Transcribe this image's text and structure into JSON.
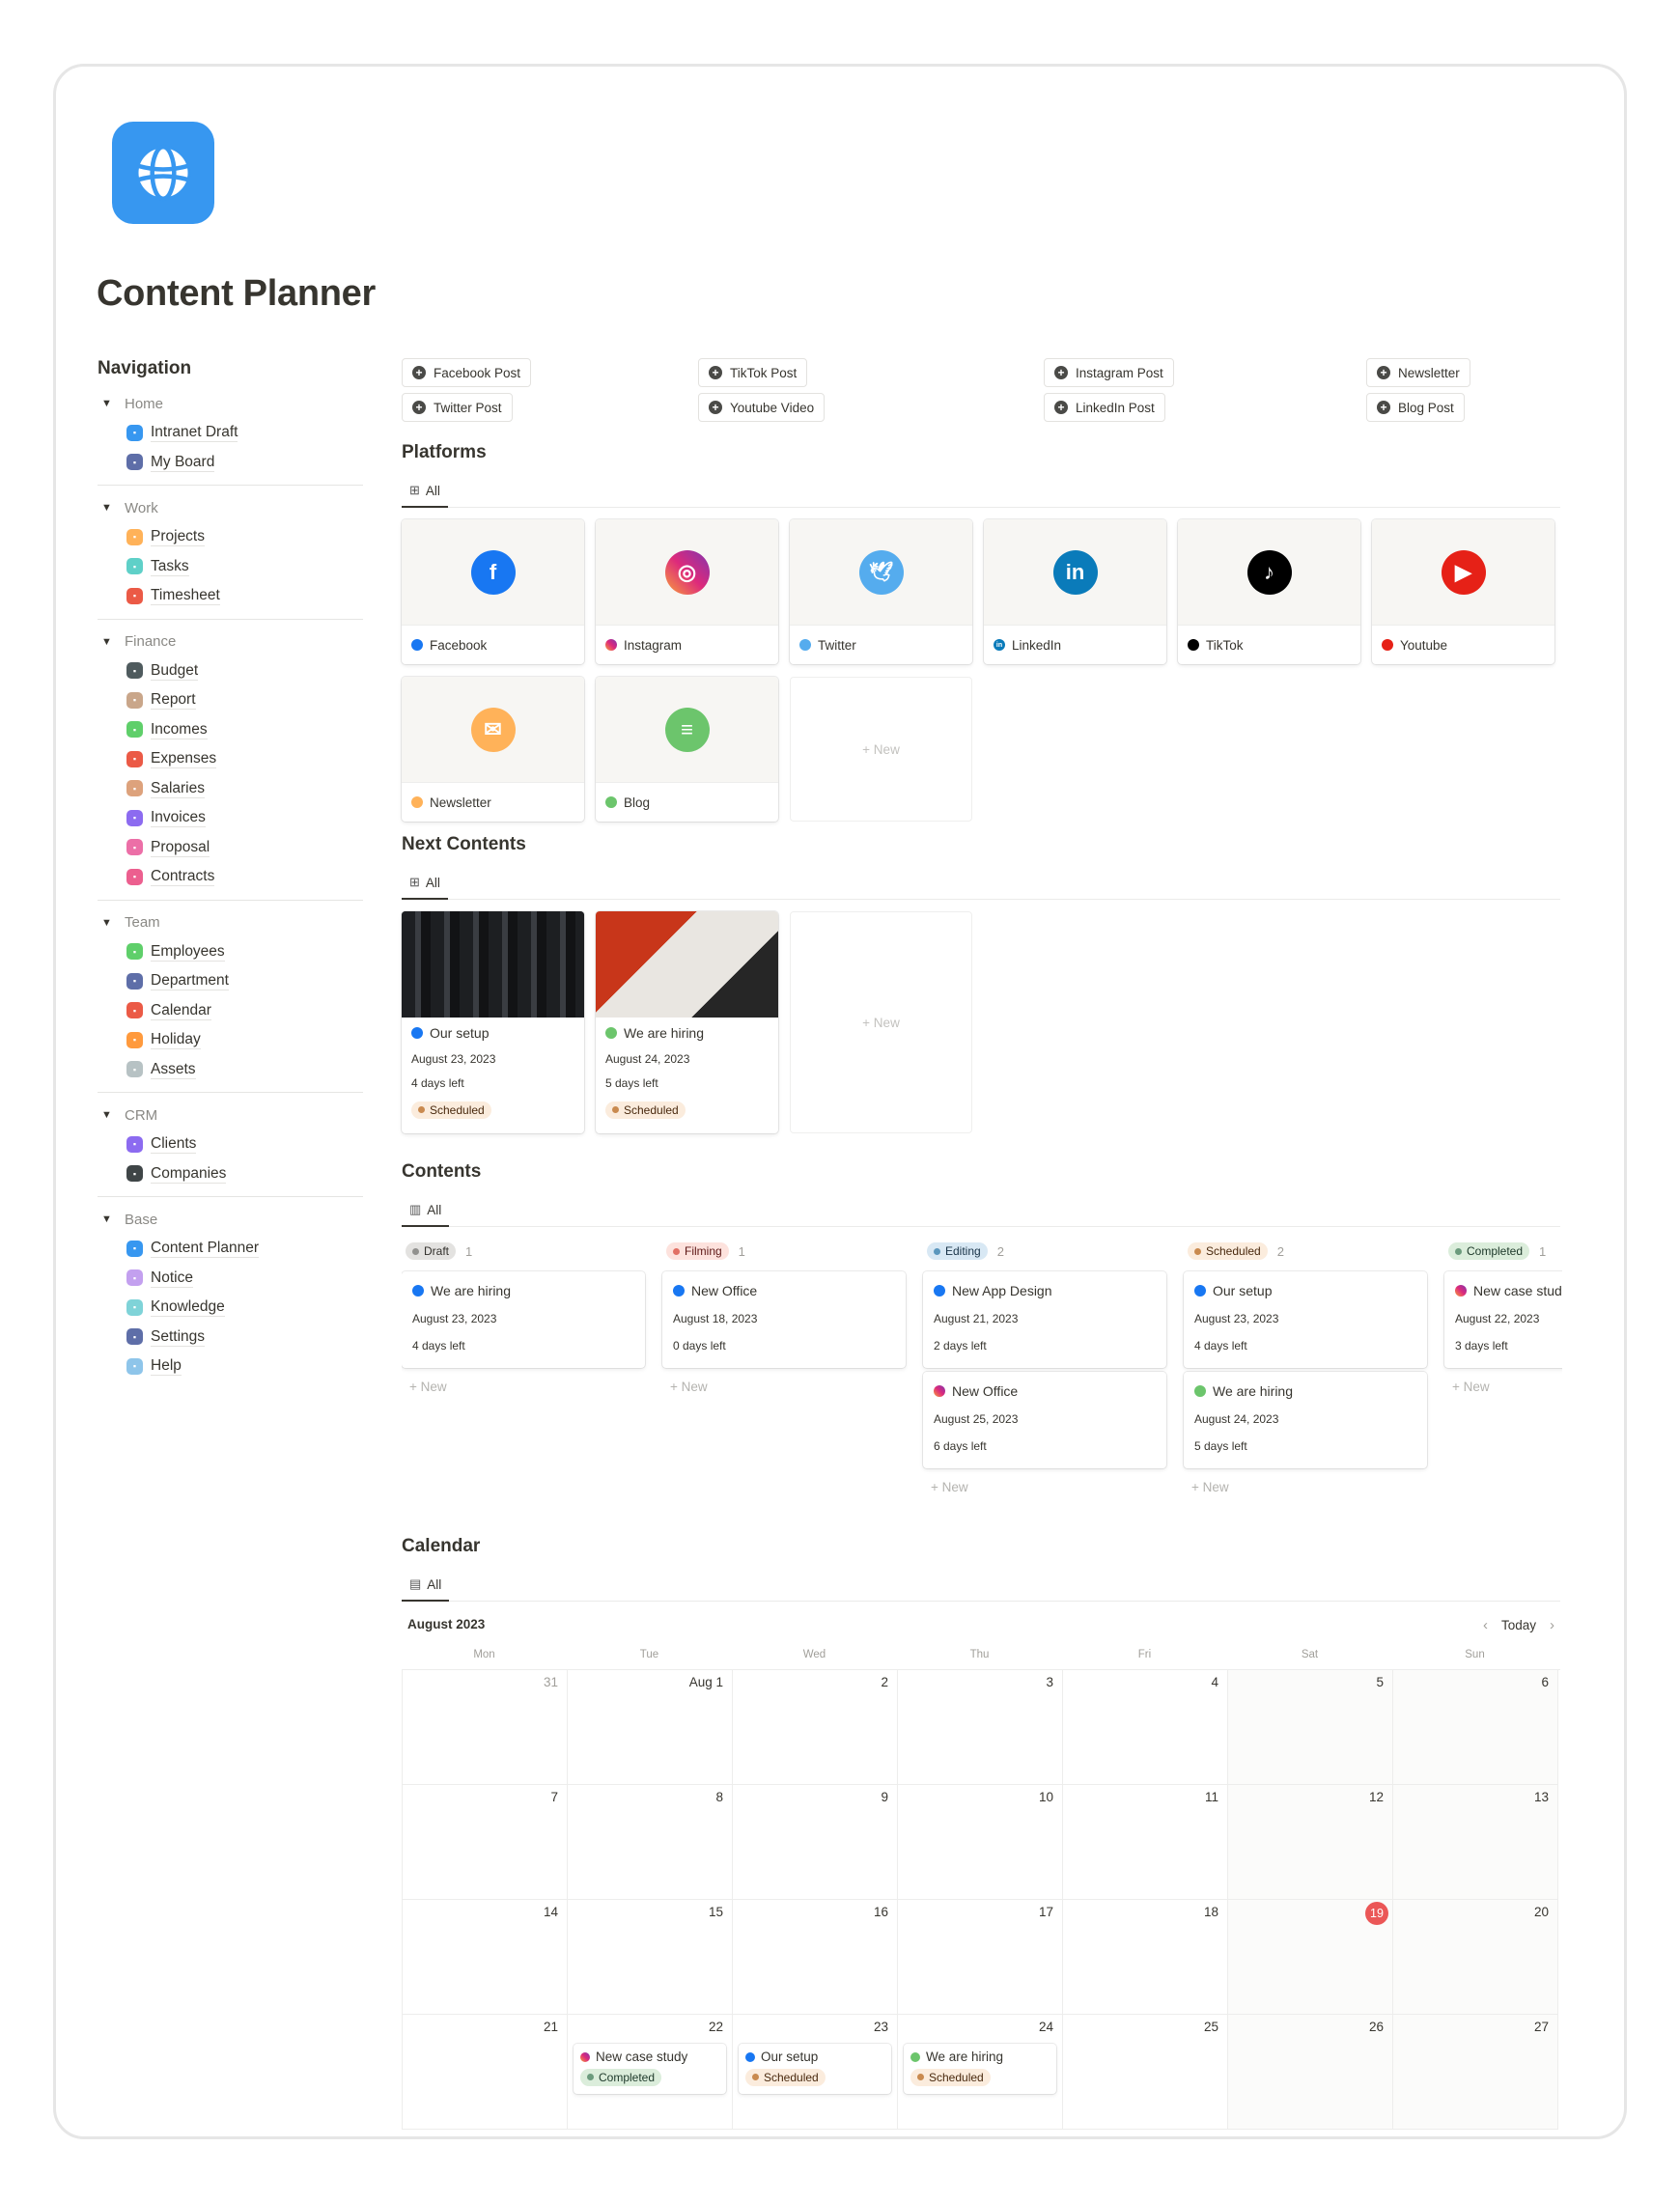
{
  "page": {
    "title": "Content Planner",
    "icon": "globe-icon",
    "accent": "#3797f0"
  },
  "sidebar": {
    "heading": "Navigation",
    "groups": [
      {
        "title": "Home",
        "items": [
          {
            "label": "Intranet Draft",
            "icon": "intranet-icon",
            "color": "#3797f0"
          },
          {
            "label": "My Board",
            "icon": "user-icon",
            "color": "#5e6ea8"
          }
        ]
      },
      {
        "title": "Work",
        "items": [
          {
            "label": "Projects",
            "icon": "folder-icon",
            "color": "#ffb259"
          },
          {
            "label": "Tasks",
            "icon": "check-icon",
            "color": "#5fd0c8"
          },
          {
            "label": "Timesheet",
            "icon": "clock-icon",
            "color": "#eb5a46"
          }
        ]
      },
      {
        "title": "Finance",
        "items": [
          {
            "label": "Budget",
            "icon": "budget-icon",
            "color": "#4f5b5e"
          },
          {
            "label": "Report",
            "icon": "report-icon",
            "color": "#c9a68a"
          },
          {
            "label": "Incomes",
            "icon": "incomes-icon",
            "color": "#5fcf6a"
          },
          {
            "label": "Expenses",
            "icon": "expenses-icon",
            "color": "#eb5a46"
          },
          {
            "label": "Salaries",
            "icon": "salaries-icon",
            "color": "#dda27c"
          },
          {
            "label": "Invoices",
            "icon": "invoice-icon",
            "color": "#8c6bf0"
          },
          {
            "label": "Proposal",
            "icon": "proposal-icon",
            "color": "#ec6fa7"
          },
          {
            "label": "Contracts",
            "icon": "contract-icon",
            "color": "#ec5f8f"
          }
        ]
      },
      {
        "title": "Team",
        "items": [
          {
            "label": "Employees",
            "icon": "employees-icon",
            "color": "#5fcf6a"
          },
          {
            "label": "Department",
            "icon": "department-icon",
            "color": "#5e6ea8"
          },
          {
            "label": "Calendar",
            "icon": "calendar-icon",
            "color": "#eb5a46"
          },
          {
            "label": "Holiday",
            "icon": "holiday-icon",
            "color": "#ff9a3d"
          },
          {
            "label": "Assets",
            "icon": "assets-icon",
            "color": "#b7c2c4"
          }
        ]
      },
      {
        "title": "CRM",
        "items": [
          {
            "label": "Clients",
            "icon": "clients-icon",
            "color": "#8c6bf0"
          },
          {
            "label": "Companies",
            "icon": "companies-icon",
            "color": "#3f4547"
          }
        ]
      },
      {
        "title": "Base",
        "items": [
          {
            "label": "Content Planner",
            "icon": "globe-icon",
            "color": "#3797f0"
          },
          {
            "label": "Notice",
            "icon": "notice-icon",
            "color": "#c3a0ef"
          },
          {
            "label": "Knowledge",
            "icon": "knowledge-icon",
            "color": "#7fd3d8"
          },
          {
            "label": "Settings",
            "icon": "settings-icon",
            "color": "#5e6ea8"
          },
          {
            "label": "Help",
            "icon": "help-icon",
            "color": "#8ec5ea"
          }
        ]
      }
    ]
  },
  "quick_buttons": [
    "Facebook Post",
    "Twitter Post",
    "TikTok Post",
    "Youtube Video",
    "Instagram Post",
    "LinkedIn Post",
    "Newsletter",
    "Blog Post"
  ],
  "platforms": {
    "title": "Platforms",
    "view_label": "All",
    "items": [
      {
        "label": "Facebook",
        "icon": "facebook-icon",
        "glyph": "f",
        "color": "#1877f2"
      },
      {
        "label": "Instagram",
        "icon": "instagram-icon",
        "glyph": "◎",
        "color": "#dd2a7b"
      },
      {
        "label": "Twitter",
        "icon": "twitter-icon",
        "glyph": "🕊",
        "color": "#55acee"
      },
      {
        "label": "LinkedIn",
        "icon": "linkedin-icon",
        "glyph": "in",
        "color": "#0a7bba"
      },
      {
        "label": "TikTok",
        "icon": "tiktok-icon",
        "glyph": "♪",
        "color": "#000000"
      },
      {
        "label": "Youtube",
        "icon": "youtube-icon",
        "glyph": "▶",
        "color": "#e62117"
      },
      {
        "label": "Newsletter",
        "icon": "mail-icon",
        "glyph": "✉",
        "color": "#ffb259"
      },
      {
        "label": "Blog",
        "icon": "blog-icon",
        "glyph": "≡",
        "color": "#6cc56c"
      }
    ],
    "new_label": "New"
  },
  "next_contents": {
    "title": "Next Contents",
    "view_label": "All",
    "items": [
      {
        "title": "Our setup",
        "platform": "Facebook",
        "date": "August 23, 2023",
        "remaining": "4 days left",
        "status": "Scheduled"
      },
      {
        "title": "We are hiring",
        "platform": "Blog",
        "date": "August 24, 2023",
        "remaining": "5 days left",
        "status": "Scheduled"
      }
    ],
    "new_label": "New"
  },
  "contents": {
    "title": "Contents",
    "view_label": "All",
    "columns": [
      {
        "status": "Draft",
        "count": "1",
        "bg": "#e3e2e0",
        "dot": "#91918e",
        "fg": "#32302c",
        "cards": [
          {
            "title": "We are hiring",
            "platform": "Facebook",
            "date": "August 23, 2023",
            "remaining": "4 days left"
          }
        ]
      },
      {
        "status": "Filming",
        "count": "1",
        "bg": "#fde2dd",
        "dot": "#e16f64",
        "fg": "#5d1715",
        "cards": [
          {
            "title": "New Office",
            "platform": "Facebook",
            "date": "August 18, 2023",
            "remaining": "0 days left"
          }
        ]
      },
      {
        "status": "Editing",
        "count": "2",
        "bg": "#d8e8f4",
        "dot": "#5b97bd",
        "fg": "#183347",
        "cards": [
          {
            "title": "New App Design",
            "platform": "Facebook",
            "date": "August 21, 2023",
            "remaining": "2 days left"
          },
          {
            "title": "New Office",
            "platform": "Instagram",
            "date": "August 25, 2023",
            "remaining": "6 days left"
          }
        ]
      },
      {
        "status": "Scheduled",
        "count": "2",
        "bg": "#fbecdd",
        "dot": "#c98a4f",
        "fg": "#49290e",
        "cards": [
          {
            "title": "Our setup",
            "platform": "Facebook",
            "date": "August 23, 2023",
            "remaining": "4 days left"
          },
          {
            "title": "We are hiring",
            "platform": "Blog",
            "date": "August 24, 2023",
            "remaining": "5 days left"
          }
        ]
      },
      {
        "status": "Completed",
        "count": "1",
        "bg": "#dbeddb",
        "dot": "#6c9b7d",
        "fg": "#1c3829",
        "cards": [
          {
            "title": "New case study",
            "platform": "Instagram",
            "date": "August 22, 2023",
            "remaining": "3 days left"
          }
        ]
      }
    ],
    "new_label": "New"
  },
  "calendar": {
    "title": "Calendar",
    "view_label": "All",
    "month": "August 2023",
    "today_label": "Today",
    "weekdays": [
      "Mon",
      "Tue",
      "Wed",
      "Thu",
      "Fri",
      "Sat",
      "Sun"
    ],
    "today": "19",
    "weeks": [
      [
        "31",
        "Aug 1",
        "2",
        "3",
        "4",
        "5",
        "6"
      ],
      [
        "7",
        "8",
        "9",
        "10",
        "11",
        "12",
        "13"
      ],
      [
        "14",
        "15",
        "16",
        "17",
        "18",
        "19",
        "20"
      ],
      [
        "21",
        "22",
        "23",
        "24",
        "25",
        "26",
        "27"
      ]
    ],
    "events": [
      {
        "day": "22",
        "title": "New case study",
        "platform": "Instagram",
        "status": "Completed"
      },
      {
        "day": "23",
        "title": "Our setup",
        "platform": "Facebook",
        "status": "Scheduled"
      },
      {
        "day": "24",
        "title": "We are hiring",
        "platform": "Blog",
        "status": "Scheduled"
      }
    ]
  }
}
